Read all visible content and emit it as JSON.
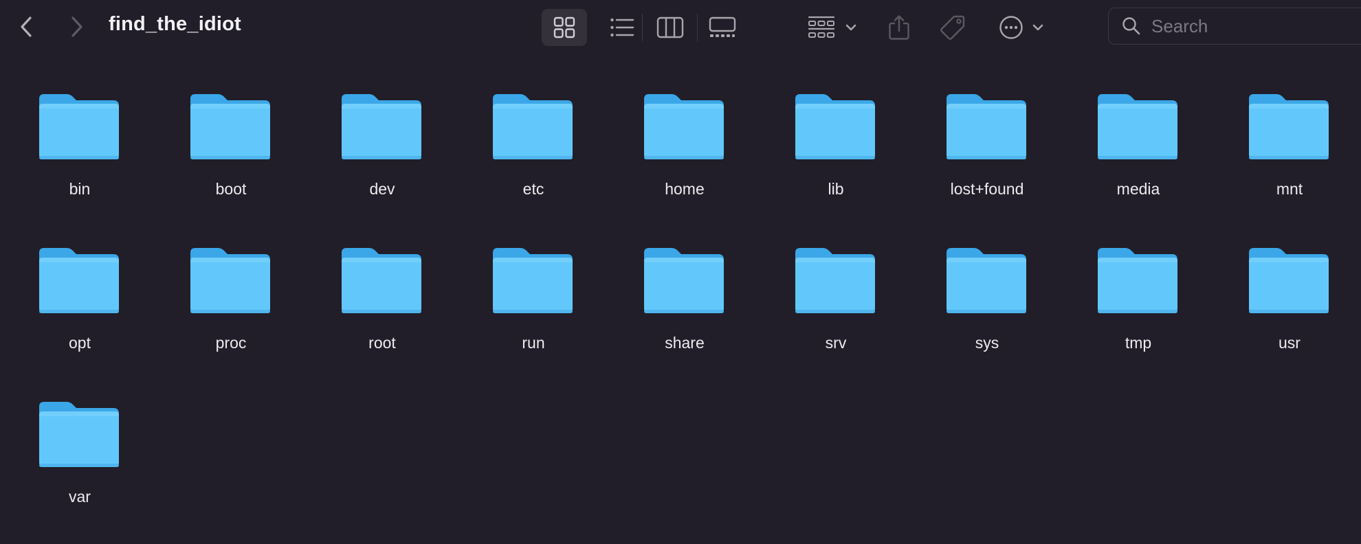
{
  "window": {
    "title": "find_the_idiot"
  },
  "toolbar": {
    "back_icon": "chevron-left-icon",
    "forward_icon": "chevron-right-icon",
    "view_modes": [
      "icons",
      "list",
      "columns",
      "gallery"
    ],
    "active_view": "icons",
    "group_icon": "group-grid-icon",
    "share_icon": "share-icon",
    "tag_icon": "tag-icon",
    "more_icon": "ellipsis-circle-icon"
  },
  "search": {
    "placeholder": "Search",
    "value": ""
  },
  "colors": {
    "background": "#211e29",
    "folder_body": "#62c8fb",
    "folder_back": "#3ba7e8",
    "toolbar_icon": "#a9a7ad",
    "toolbar_icon_disabled": "#5b5862",
    "active_view_bg": "#34313b"
  },
  "folders": [
    {
      "name": "bin"
    },
    {
      "name": "boot"
    },
    {
      "name": "dev"
    },
    {
      "name": "etc"
    },
    {
      "name": "home"
    },
    {
      "name": "lib"
    },
    {
      "name": "lost+found"
    },
    {
      "name": "media"
    },
    {
      "name": "mnt"
    },
    {
      "name": "opt"
    },
    {
      "name": "proc"
    },
    {
      "name": "root"
    },
    {
      "name": "run"
    },
    {
      "name": "share"
    },
    {
      "name": "srv"
    },
    {
      "name": "sys"
    },
    {
      "name": "tmp"
    },
    {
      "name": "usr"
    },
    {
      "name": "var"
    }
  ]
}
